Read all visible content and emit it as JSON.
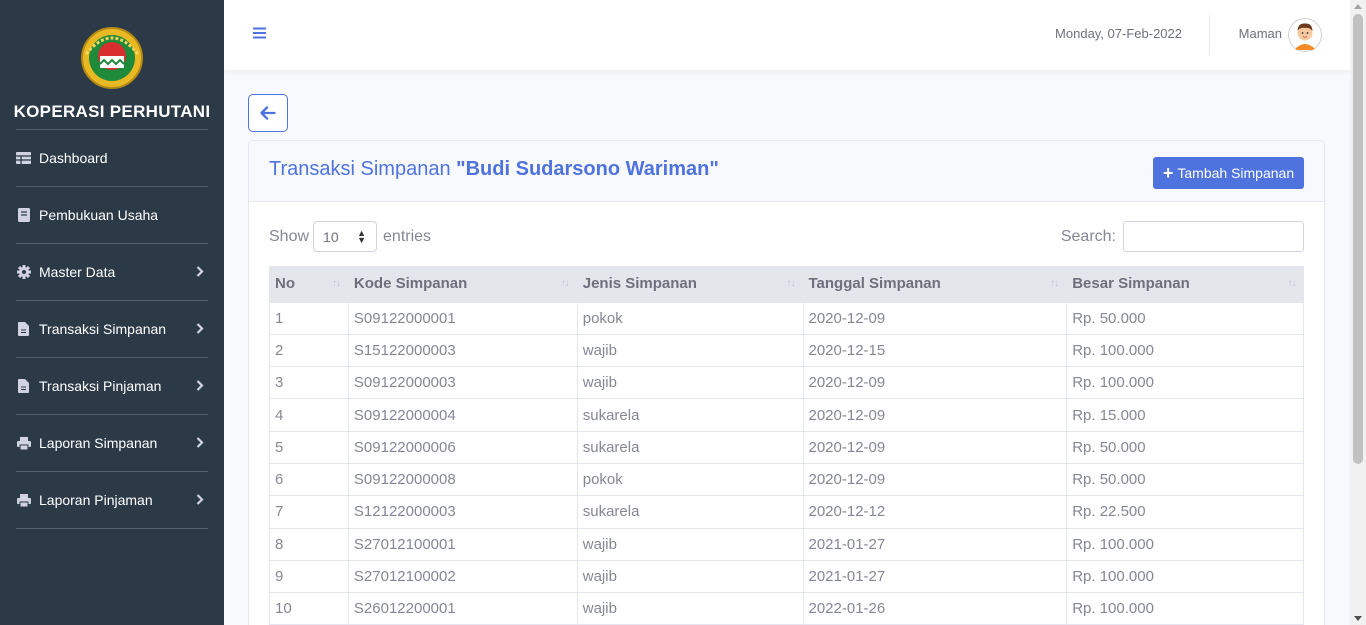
{
  "sidebar": {
    "brand": "KOPERASI PERHUTANI",
    "items": [
      {
        "label": "Dashboard",
        "icon": "dashboard-icon",
        "has_chevron": false
      },
      {
        "label": "Pembukuan Usaha",
        "icon": "book-icon",
        "has_chevron": false
      },
      {
        "label": "Master Data",
        "icon": "gear-icon",
        "has_chevron": true
      },
      {
        "label": "Transaksi Simpanan",
        "icon": "file-icon",
        "has_chevron": true
      },
      {
        "label": "Transaksi Pinjaman",
        "icon": "file-icon",
        "has_chevron": true
      },
      {
        "label": "Laporan Simpanan",
        "icon": "print-icon",
        "has_chevron": true
      },
      {
        "label": "Laporan Pinjaman",
        "icon": "print-icon",
        "has_chevron": true
      }
    ]
  },
  "topbar": {
    "date": "Monday, 07-Feb-2022",
    "username": "Maman"
  },
  "card": {
    "title_prefix": "Transaksi Simpanan ",
    "title_name": "\"Budi Sudarsono Wariman\"",
    "add_button": "Tambah Simpanan"
  },
  "table_controls": {
    "show_label": "Show",
    "entries_value": "10",
    "entries_label": "entries",
    "search_label": "Search:"
  },
  "table": {
    "columns": [
      "No",
      "Kode Simpanan",
      "Jenis Simpanan",
      "Tanggal Simpanan",
      "Besar Simpanan"
    ],
    "rows": [
      [
        "1",
        "S09122000001",
        "pokok",
        "2020-12-09",
        "Rp. 50.000"
      ],
      [
        "2",
        "S15122000003",
        "wajib",
        "2020-12-15",
        "Rp. 100.000"
      ],
      [
        "3",
        "S09122000003",
        "wajib",
        "2020-12-09",
        "Rp. 100.000"
      ],
      [
        "4",
        "S09122000004",
        "sukarela",
        "2020-12-09",
        "Rp. 15.000"
      ],
      [
        "5",
        "S09122000006",
        "sukarela",
        "2020-12-09",
        "Rp. 50.000"
      ],
      [
        "6",
        "S09122000008",
        "pokok",
        "2020-12-09",
        "Rp. 50.000"
      ],
      [
        "7",
        "S12122000003",
        "sukarela",
        "2020-12-12",
        "Rp. 22.500"
      ],
      [
        "8",
        "S27012100001",
        "wajib",
        "2021-01-27",
        "Rp. 100.000"
      ],
      [
        "9",
        "S27012100002",
        "wajib",
        "2021-01-27",
        "Rp. 100.000"
      ],
      [
        "10",
        "S26012200001",
        "wajib",
        "2022-01-26",
        "Rp. 100.000"
      ]
    ]
  },
  "colors": {
    "sidebar_bg": "#2c3a47",
    "primary": "#4e73df",
    "text_muted": "#858796"
  }
}
